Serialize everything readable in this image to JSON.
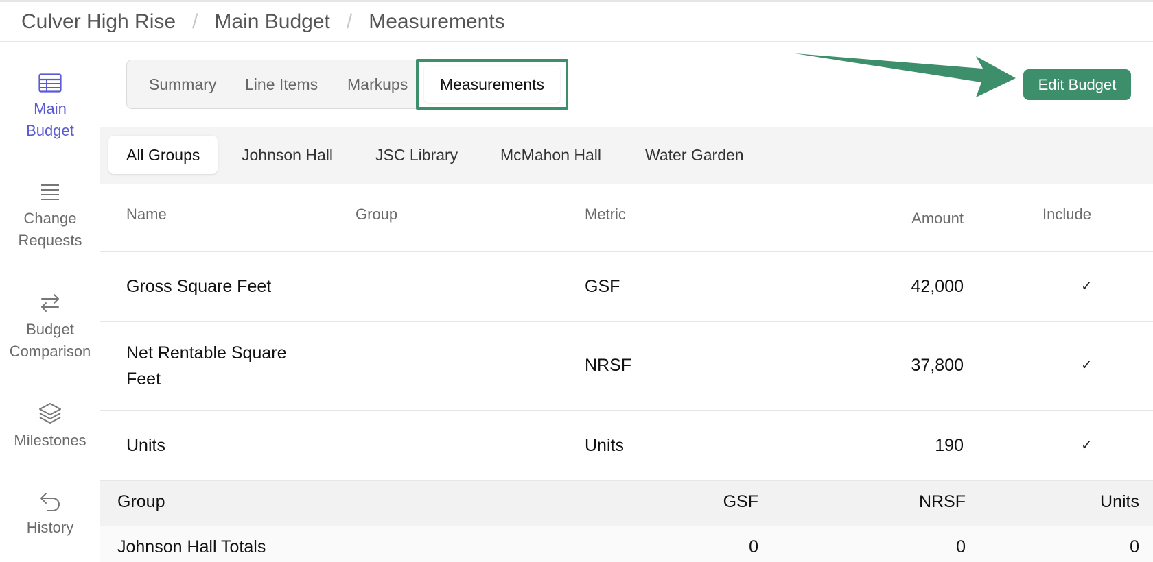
{
  "breadcrumb": [
    "Culver High Rise",
    "Main Budget",
    "Measurements"
  ],
  "breadcrumb_separator": "/",
  "sidebar": {
    "items": [
      {
        "line1": "Main",
        "line2": "Budget",
        "icon": "table-icon"
      },
      {
        "line1": "Change",
        "line2": "Requests",
        "icon": "list-icon"
      },
      {
        "line1": "Budget",
        "line2": "Comparison",
        "icon": "swap-icon"
      },
      {
        "line1": "Milestones",
        "line2": "",
        "icon": "layers-icon"
      },
      {
        "line1": "History",
        "line2": "",
        "icon": "undo-icon"
      }
    ],
    "active_color": "#5b5bd6"
  },
  "tabs": [
    "Summary",
    "Line Items",
    "Markups",
    "Measurements"
  ],
  "active_tab": "Measurements",
  "edit_button": "Edit Budget",
  "accent_color": "#3d8e6b",
  "group_tabs": [
    "All Groups",
    "Johnson Hall",
    "JSC Library",
    "McMahon Hall",
    "Water Garden"
  ],
  "active_group": "All Groups",
  "table": {
    "headers": {
      "name": "Name",
      "group": "Group",
      "metric": "Metric",
      "amount": "Amount",
      "include": "Include"
    },
    "rows": [
      {
        "name": "Gross Square Feet",
        "group": "",
        "metric": "GSF",
        "amount": "42,000",
        "include": "✓"
      },
      {
        "name_line1": "Net Rentable Square",
        "name_line2": "Feet",
        "group": "",
        "metric": "NRSF",
        "amount": "37,800",
        "include": "✓"
      },
      {
        "name": "Units",
        "group": "",
        "metric": "Units",
        "amount": "190",
        "include": "✓"
      }
    ]
  },
  "totals": {
    "headers": {
      "group": "Group",
      "gsf": "GSF",
      "nrsf": "NRSF",
      "units": "Units"
    },
    "rows": [
      {
        "group": "Johnson Hall Totals",
        "gsf": "0",
        "nrsf": "0",
        "units": "0"
      }
    ]
  }
}
